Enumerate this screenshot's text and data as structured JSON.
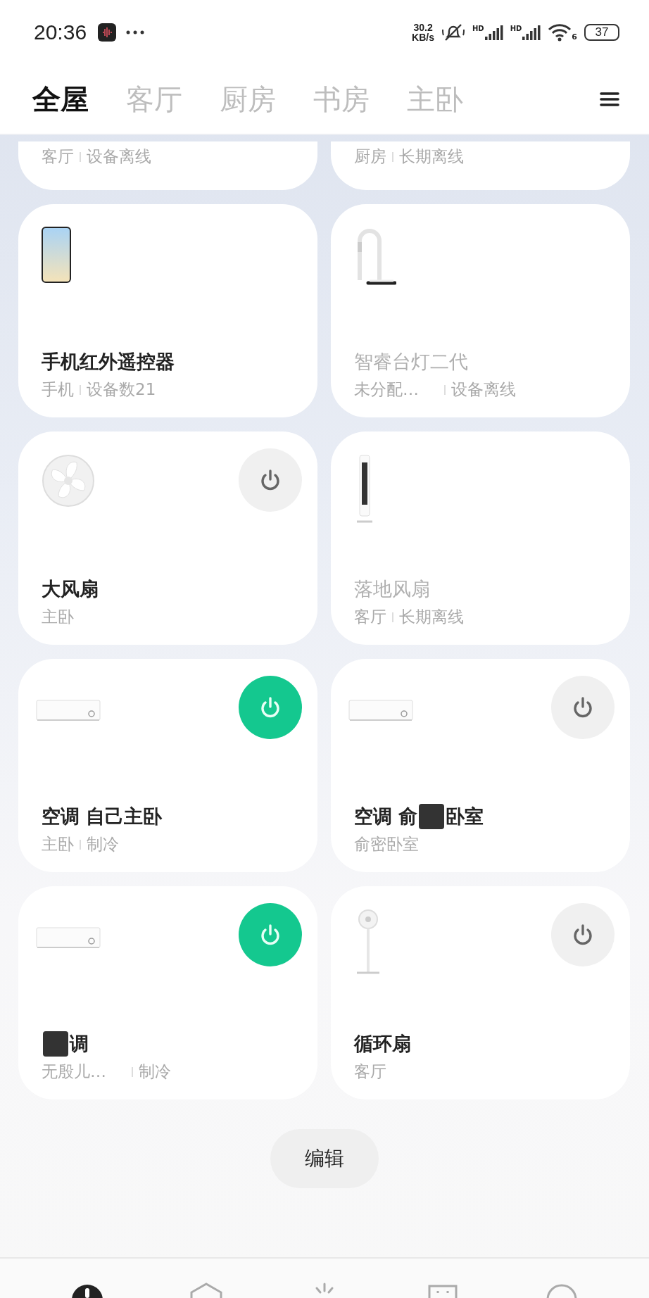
{
  "status_bar": {
    "time": "20:36",
    "net_speed": [
      "30.2",
      "KB/s"
    ],
    "signal_labels": [
      "HD",
      "HD"
    ],
    "wifi_label": "6",
    "battery": "37"
  },
  "tabs": [
    {
      "label": "全屋",
      "selected": true
    },
    {
      "label": "客厅",
      "selected": false
    },
    {
      "label": "厨房",
      "selected": false
    },
    {
      "label": "书房",
      "selected": false
    },
    {
      "label": "主卧",
      "selected": false
    }
  ],
  "devices": [
    {
      "room": "客厅",
      "status": "设备离线",
      "partial": true
    },
    {
      "room": "厨房",
      "status": "长期离线",
      "partial": true
    },
    {
      "kind": "phone",
      "name_parts": [
        "手机红外遥控器"
      ],
      "room": "手机",
      "status": "设备数21",
      "offline": false
    },
    {
      "kind": "lamp",
      "name_parts": [
        "智睿台灯二代"
      ],
      "room": "未分配…",
      "status": "设备离线",
      "offline": true,
      "gap": true
    },
    {
      "kind": "fan",
      "name_parts": [
        "大风扇"
      ],
      "room": "主卧",
      "offline": false,
      "power_button": {
        "on": false
      }
    },
    {
      "kind": "tower",
      "name_parts": [
        "落地风扇"
      ],
      "room": "客厅",
      "status": "长期离线",
      "offline": true
    },
    {
      "kind": "ac",
      "name_parts": [
        "空调 自己主卧"
      ],
      "room": "主卧",
      "status": "制冷",
      "offline": false,
      "power_button": {
        "on": true
      }
    },
    {
      "kind": "ac",
      "name_parts": [
        "空调 俞",
        "卧室"
      ],
      "room": "俞密卧室",
      "offline": false,
      "power_button": {
        "on": false
      }
    },
    {
      "kind": "ac",
      "name_parts": [
        "调"
      ],
      "redacted_lead": true,
      "room": "无殷儿…",
      "status": "制冷",
      "offline": false,
      "gap": true,
      "power_button": {
        "on": true
      }
    },
    {
      "kind": "pedestal",
      "name_parts": [
        "循环扇"
      ],
      "room": "客厅",
      "offline": false,
      "power_button": {
        "on": false
      }
    }
  ],
  "edit_button": "编辑"
}
